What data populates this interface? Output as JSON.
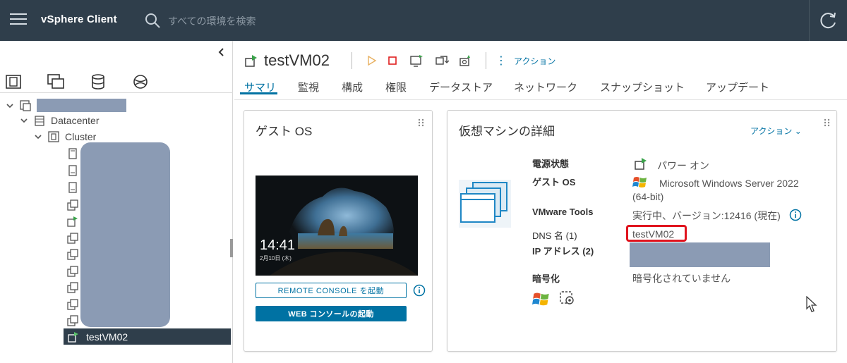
{
  "header": {
    "app_title": "vSphere Client",
    "search_placeholder": "すべての環境を検索"
  },
  "navigator": {
    "datacenter": "Datacenter",
    "cluster": "Cluster",
    "selected_vm": "testVM02"
  },
  "vm": {
    "name": "testVM02",
    "actions_label": "アクション"
  },
  "tabs": [
    "サマリ",
    "監視",
    "構成",
    "権限",
    "データストア",
    "ネットワーク",
    "スナップショット",
    "アップデート"
  ],
  "guest_os_card": {
    "title": "ゲスト OS",
    "clock_time": "14:41",
    "clock_date": "2月10日 (木)",
    "remote_console_label": "REMOTE CONSOLE を起動",
    "web_console_label": "WEB コンソールの起動"
  },
  "details_card": {
    "title": "仮想マシンの詳細",
    "actions_label": "アクション",
    "rows": {
      "power_label": "電源状態",
      "power_value": "パワー オン",
      "guest_os_label": "ゲスト OS",
      "guest_os_value": "Microsoft Windows Server 2022",
      "guest_os_value2": "(64-bit)",
      "vmware_tools_label": "VMware Tools",
      "vmware_tools_value": "実行中、バージョン:12416 (現在)",
      "dns_label": "DNS 名 (1)",
      "dns_value": "testVM02",
      "ip_label": "IP アドレス (2)",
      "encryption_label": "暗号化",
      "encryption_value": "暗号化されていません"
    }
  },
  "colors": {
    "header_bg": "#2f3e4b",
    "accent": "#0072a3",
    "highlight": "#e0141e",
    "redaction": "#8b9bb4"
  }
}
